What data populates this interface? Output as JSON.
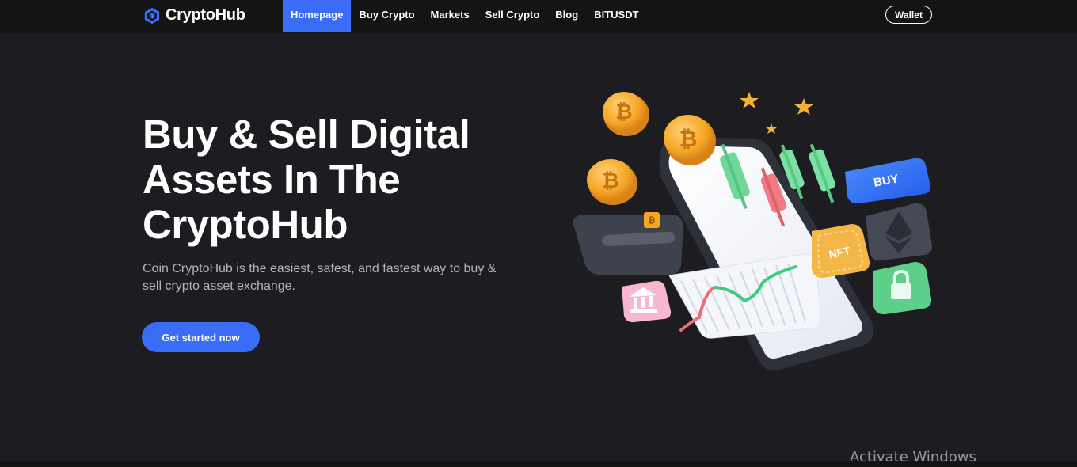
{
  "brand": {
    "name": "CryptoHub",
    "logo_icon": "cube-icon",
    "accent": "#3b6cf6"
  },
  "nav": {
    "items": [
      {
        "label": "Homepage",
        "active": true
      },
      {
        "label": "Buy Crypto",
        "active": false
      },
      {
        "label": "Markets",
        "active": false
      },
      {
        "label": "Sell Crypto",
        "active": false
      },
      {
        "label": "Blog",
        "active": false
      },
      {
        "label": "BITUSDT",
        "active": false
      }
    ],
    "wallet_label": "Wallet"
  },
  "hero": {
    "title": "Buy & Sell Digital Assets In The CryptoHub",
    "description": "Coin CryptoHub is the easiest, safest, and fastest way to buy & sell crypto asset exchange.",
    "cta_label": "Get started now"
  },
  "illustration": {
    "buy_label": "BUY",
    "nft_label": "NFT",
    "icons": [
      "bitcoin-coin-icon",
      "ethereum-icon",
      "lock-icon",
      "bank-icon",
      "credit-card-icon",
      "star-icon",
      "candlestick-chart-icon"
    ]
  },
  "system": {
    "watermark": "Activate Windows"
  }
}
